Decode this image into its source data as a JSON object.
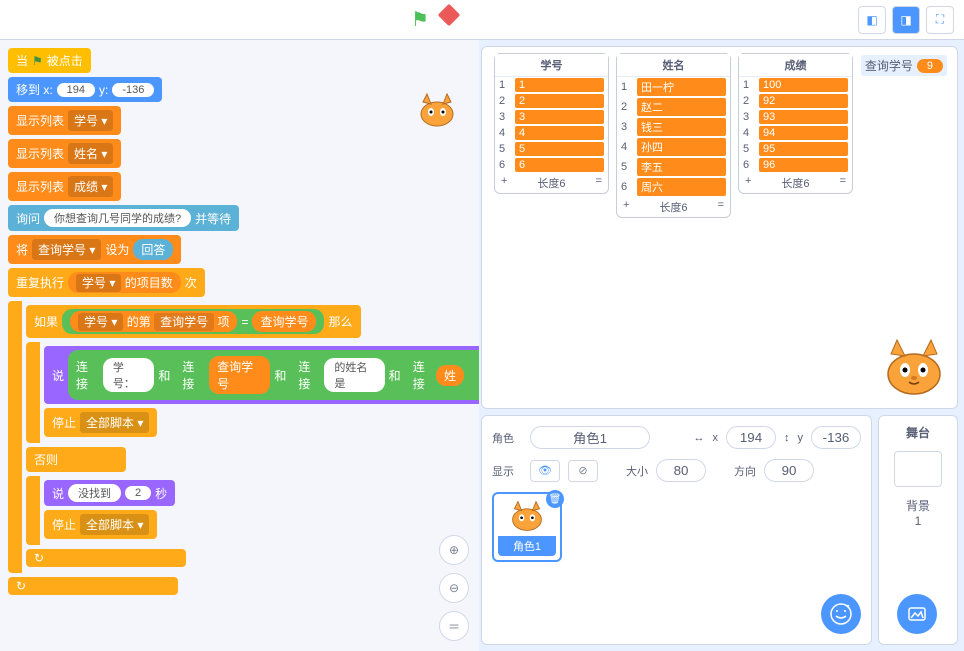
{
  "topbar": {
    "flag": "⚑",
    "stop": "■",
    "modes": [
      "◫",
      "▭",
      "⛶"
    ]
  },
  "readout": {
    "label": "查询学号",
    "value": "9"
  },
  "monitors": [
    {
      "title": "学号",
      "rows": [
        {
          "i": "1",
          "v": "1"
        },
        {
          "i": "2",
          "v": "2"
        },
        {
          "i": "3",
          "v": "3"
        },
        {
          "i": "4",
          "v": "4"
        },
        {
          "i": "5",
          "v": "5"
        },
        {
          "i": "6",
          "v": "6"
        }
      ],
      "len": "长度6"
    },
    {
      "title": "姓名",
      "rows": [
        {
          "i": "1",
          "v": "田一柠"
        },
        {
          "i": "2",
          "v": "赵二"
        },
        {
          "i": "3",
          "v": "钱三"
        },
        {
          "i": "4",
          "v": "孙四"
        },
        {
          "i": "5",
          "v": "李五"
        },
        {
          "i": "6",
          "v": "周六"
        }
      ],
      "len": "长度6"
    },
    {
      "title": "成绩",
      "rows": [
        {
          "i": "1",
          "v": "100"
        },
        {
          "i": "2",
          "v": "92"
        },
        {
          "i": "3",
          "v": "93"
        },
        {
          "i": "4",
          "v": "94"
        },
        {
          "i": "5",
          "v": "95"
        },
        {
          "i": "6",
          "v": "96"
        }
      ],
      "len": "长度6"
    }
  ],
  "sprite": {
    "label": "角色",
    "name": "角色1",
    "x_lbl": "x",
    "x": "194",
    "y_lbl": "y",
    "y": "-136",
    "show": "显示",
    "size_lbl": "大小",
    "size": "80",
    "dir_lbl": "方向",
    "dir": "90"
  },
  "stage_card": {
    "title": "舞台",
    "back_lbl": "背景",
    "back": "1"
  },
  "blocks": {
    "when": "当",
    "clicked": "被点击",
    "goto": "移到 x:",
    "gx": "194",
    "gy": "-136",
    "ylbl": "y:",
    "showlist": "显示列表",
    "l1": "学号 ▾",
    "l2": "姓名 ▾",
    "l3": "成绩 ▾",
    "ask": "询问",
    "q": "你想查询几号同学的成绩?",
    "wait": "并等待",
    "set": "将",
    "var": "查询学号 ▾",
    "setto": "设为",
    "answer": "回答",
    "repeat": "重复执行",
    "of": "的项目数",
    "times": "次",
    "if": "如果",
    "item": "的第",
    "idx": "查询学号",
    "itm": "项",
    "eq": "=",
    "then": "那么",
    "say": "说",
    "join": "连接",
    "s1": "学号：",
    "and": "和",
    "s3": "的姓名是",
    "truncated": "姓",
    "stop": "停止",
    "all": "全部脚本 ▾",
    "else": "否则",
    "notfound": "没找到",
    "sec": "2",
    "secs": "秒"
  }
}
